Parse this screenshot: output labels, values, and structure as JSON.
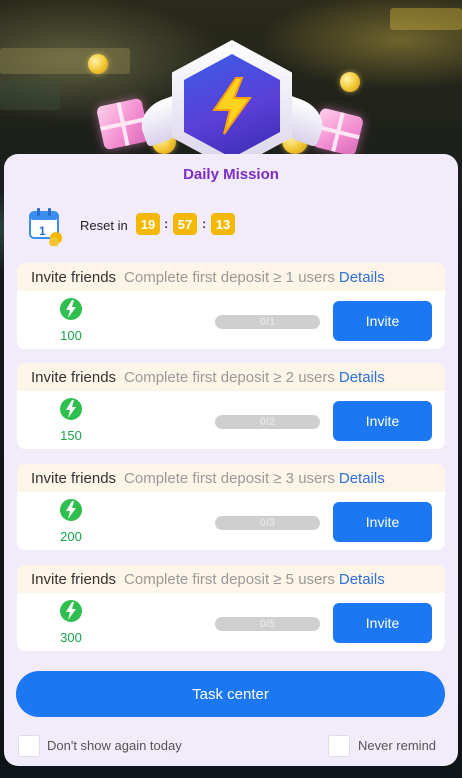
{
  "header": {
    "title": "Daily Mission"
  },
  "reset": {
    "label": "Reset in",
    "hours": "19",
    "minutes": "57",
    "seconds": "13",
    "separator": ":"
  },
  "missions": [
    {
      "title": "Invite friends",
      "requirement": "Complete first deposit ≥ 1 users",
      "details": "Details",
      "reward": "100",
      "progress": "0/1",
      "progress_fraction": 0,
      "button": "Invite"
    },
    {
      "title": "Invite friends",
      "requirement": "Complete first deposit ≥ 2 users",
      "details": "Details",
      "reward": "150",
      "progress": "0/2",
      "progress_fraction": 0,
      "button": "Invite"
    },
    {
      "title": "Invite friends",
      "requirement": "Complete first deposit ≥ 3 users",
      "details": "Details",
      "reward": "200",
      "progress": "0/3",
      "progress_fraction": 0,
      "button": "Invite"
    },
    {
      "title": "Invite friends",
      "requirement": "Complete first deposit ≥ 5 users",
      "details": "Details",
      "reward": "300",
      "progress": "0/5",
      "progress_fraction": 0,
      "button": "Invite"
    }
  ],
  "task_center": {
    "label": "Task center"
  },
  "options": {
    "dont_show_today": "Don't show again today",
    "never_remind": "Never remind"
  },
  "icons": {
    "badge": "lightning-badge-icon",
    "calendar": "calendar-coins-icon",
    "reward": "lightning-coin-icon"
  },
  "colors": {
    "accent": "#1b78f2",
    "title": "#7b2fc2",
    "timer": "#f5b800",
    "reward": "#1aa34a",
    "link": "#2e6fd8"
  }
}
